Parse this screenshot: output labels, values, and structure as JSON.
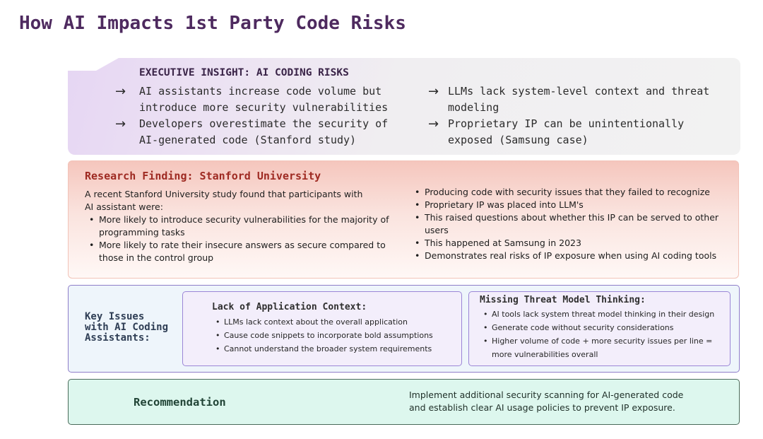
{
  "title": "How AI Impacts 1st Party Code Risks",
  "executive": {
    "heading": "EXECUTIVE INSIGHT: AI CODING RISKS",
    "arrow_glyph": "→",
    "items": [
      "AI assistants increase code volume but\nintroduce more security vulnerabilities",
      "Developers overestimate the security of\nAI-generated code (Stanford study)",
      "LLMs lack system-level context and threat\nmodeling",
      "Proprietary IP can be unintentionally\nexposed (Samsung case)"
    ]
  },
  "research": {
    "heading": "Research Finding: Stanford University",
    "intro": "A recent Stanford University study found that participants with AI assistant were:",
    "left_bullets": [
      "More likely to introduce security vulnerabilities for the majority of programming tasks",
      "More likely to rate their insecure answers as secure compared to those in the control group"
    ],
    "right_bullets": [
      "Producing code with security issues that they failed to recognize",
      "Proprietary IP was placed into LLM's",
      "This raised questions about whether this IP can be served to other users",
      "This happened at Samsung in 2023",
      "Demonstrates real risks of IP exposure when using AI coding tools"
    ]
  },
  "issues": {
    "label": "Key Issues\nwith AI Coding\nAssistants:",
    "cards": [
      {
        "title": "Lack of Application Context:",
        "items": [
          "LLMs lack context about the overall application",
          "Cause code snippets to incorporate bold assumptions",
          "Cannot understand the broader system requirements"
        ]
      },
      {
        "title": "Missing Threat Model Thinking:",
        "items": [
          "AI tools lack system threat model thinking in their design",
          "Generate code without security considerations",
          "Higher volume of code + more security issues per line = more vulnerabilities overall"
        ]
      }
    ]
  },
  "recommendation": {
    "label": "Recommendation",
    "text": "Implement additional security scanning for AI-generated code\nand  establish clear AI usage policies to prevent IP exposure."
  },
  "colors": {
    "title": "#4e2a5f",
    "research_heading": "#9e2a22",
    "card_border": "#9b86d6",
    "recommendation_bg": "#ddf7ee"
  }
}
